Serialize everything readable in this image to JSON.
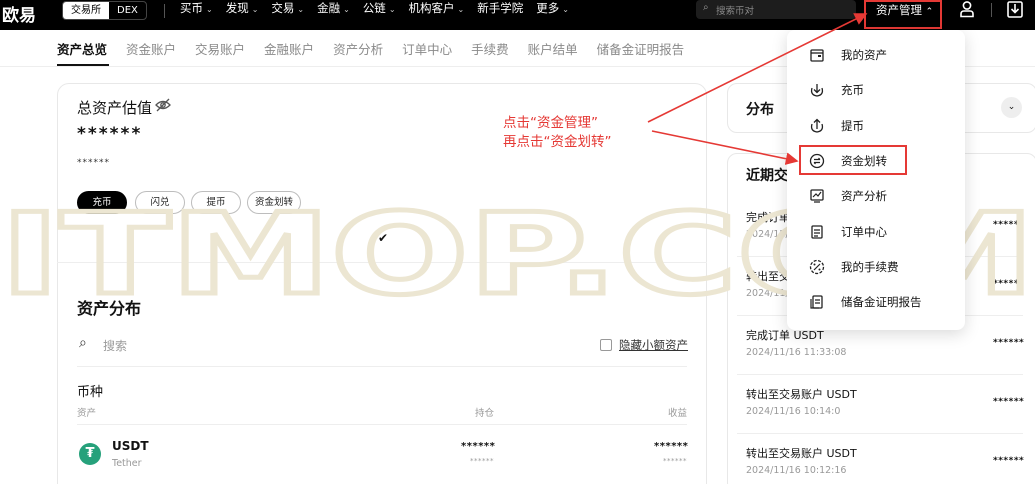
{
  "brand": {
    "logo_text": "欧易",
    "accent": "#000000",
    "highlight": "#e53935"
  },
  "header": {
    "mode_on": "交易所",
    "mode_off": "DEX",
    "nav": [
      "买币",
      "发现",
      "交易",
      "金融",
      "公链",
      "机构客户",
      "新手学院",
      "更多"
    ],
    "nav_has_chevron": [
      true,
      true,
      true,
      true,
      true,
      true,
      false,
      true
    ],
    "search_placeholder": "搜索币对",
    "asset_mgmt_label": "资产管理"
  },
  "tabs": [
    "资产总览",
    "资金账户",
    "交易账户",
    "金融账户",
    "资产分析",
    "订单中心",
    "手续费",
    "账户结单",
    "储备金证明报告"
  ],
  "overview": {
    "title": "总资产估值",
    "total_masked": "******",
    "sub_masked": "******",
    "buttons": [
      "充币",
      "闪兑",
      "提币",
      "资金划转"
    ],
    "checkmark": "✔"
  },
  "distribution": {
    "title": "资产分布",
    "search_placeholder": "搜索",
    "hide_small_label": "隐藏小额资产",
    "coin_header": "币种",
    "columns": [
      "资产",
      "持仓",
      "收益"
    ],
    "rows": [
      {
        "symbol": "USDT",
        "name": "Tether",
        "holding": "******",
        "holding_sub": "******",
        "pnl": "******",
        "pnl_sub": "******"
      }
    ]
  },
  "right_panel": {
    "distribution_title": "分布",
    "recent_title": "近期交",
    "transactions": [
      {
        "title": "完成订单",
        "time": "2024/12/",
        "amount": "******"
      },
      {
        "title": "转出至交",
        "time": "2024/11/",
        "amount": "******"
      },
      {
        "title": "完成订单 USDT",
        "time": "2024/11/16 11:33:08",
        "amount": "******"
      },
      {
        "title": "转出至交易账户 USDT",
        "time": "2024/11/16 10:14:0",
        "amount": "******"
      },
      {
        "title": "转出至交易账户 USDT",
        "time": "2024/11/16 10:12:16",
        "amount": "******"
      }
    ]
  },
  "dropdown": {
    "items": [
      {
        "label": "我的资产",
        "icon": "wallet-icon"
      },
      {
        "label": "充币",
        "icon": "deposit-icon"
      },
      {
        "label": "提币",
        "icon": "withdraw-icon"
      },
      {
        "label": "资金划转",
        "icon": "transfer-icon"
      },
      {
        "label": "资产分析",
        "icon": "analysis-icon"
      },
      {
        "label": "订单中心",
        "icon": "orders-icon"
      },
      {
        "label": "我的手续费",
        "icon": "fee-icon"
      },
      {
        "label": "储备金证明报告",
        "icon": "reserve-icon"
      }
    ]
  },
  "annotation": {
    "line1": "点击“资金管理”",
    "line2": "再点击“资金划转”"
  },
  "watermark": "ITMOP.COM"
}
